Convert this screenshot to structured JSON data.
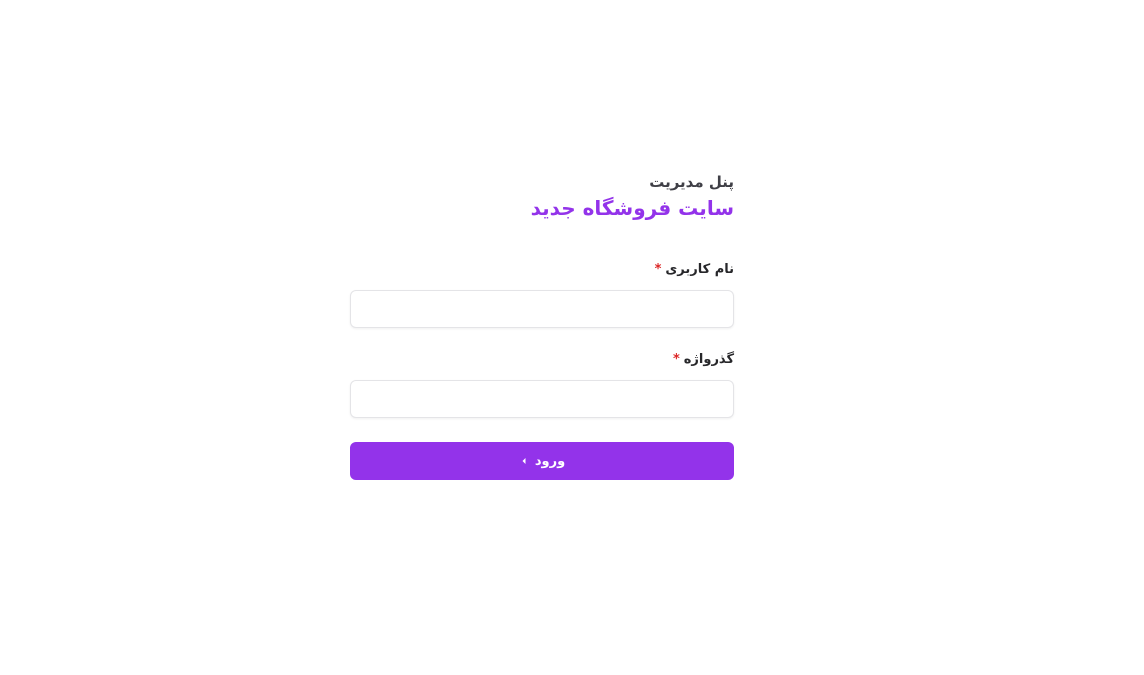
{
  "header": {
    "panel_label": "پنل مدیریت",
    "site_title": "سایت فروشگاه جدید"
  },
  "form": {
    "username": {
      "label": "نام کاربری",
      "required_mark": "*",
      "value": "",
      "placeholder": ""
    },
    "password": {
      "label": "گذرواژه",
      "required_mark": "*",
      "value": "",
      "placeholder": ""
    },
    "submit": {
      "label": "ورود",
      "icon": "chevron-left-icon"
    }
  },
  "colors": {
    "accent": "#9333ea",
    "required": "#dc2626",
    "title_text": "#3f3f46",
    "input_border": "#e4e4e7"
  }
}
